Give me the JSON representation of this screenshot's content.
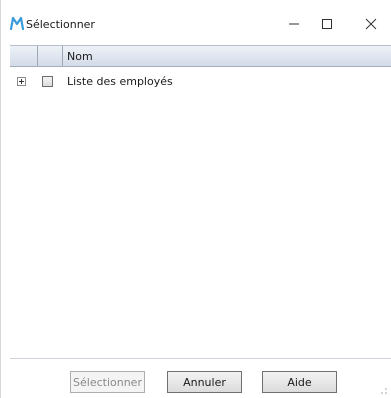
{
  "window": {
    "title": "Sélectionner",
    "app_icon": "m-logo-icon",
    "controls": {
      "minimize": "minimize-icon",
      "maximize": "maximize-icon",
      "close": "close-icon"
    }
  },
  "grid": {
    "columns": [
      "",
      "",
      "Nom"
    ],
    "rows": [
      {
        "expander": "plus-icon",
        "checked": false,
        "label": "Liste des employés"
      }
    ]
  },
  "buttons": {
    "select_label": "Sélectionner",
    "select_enabled": false,
    "cancel_label": "Annuler",
    "help_label": "Aide"
  },
  "colors": {
    "accent": "#2a8fd0",
    "header_gradient_top": "#eef2f8",
    "header_gradient_bottom": "#d3dbe8"
  }
}
